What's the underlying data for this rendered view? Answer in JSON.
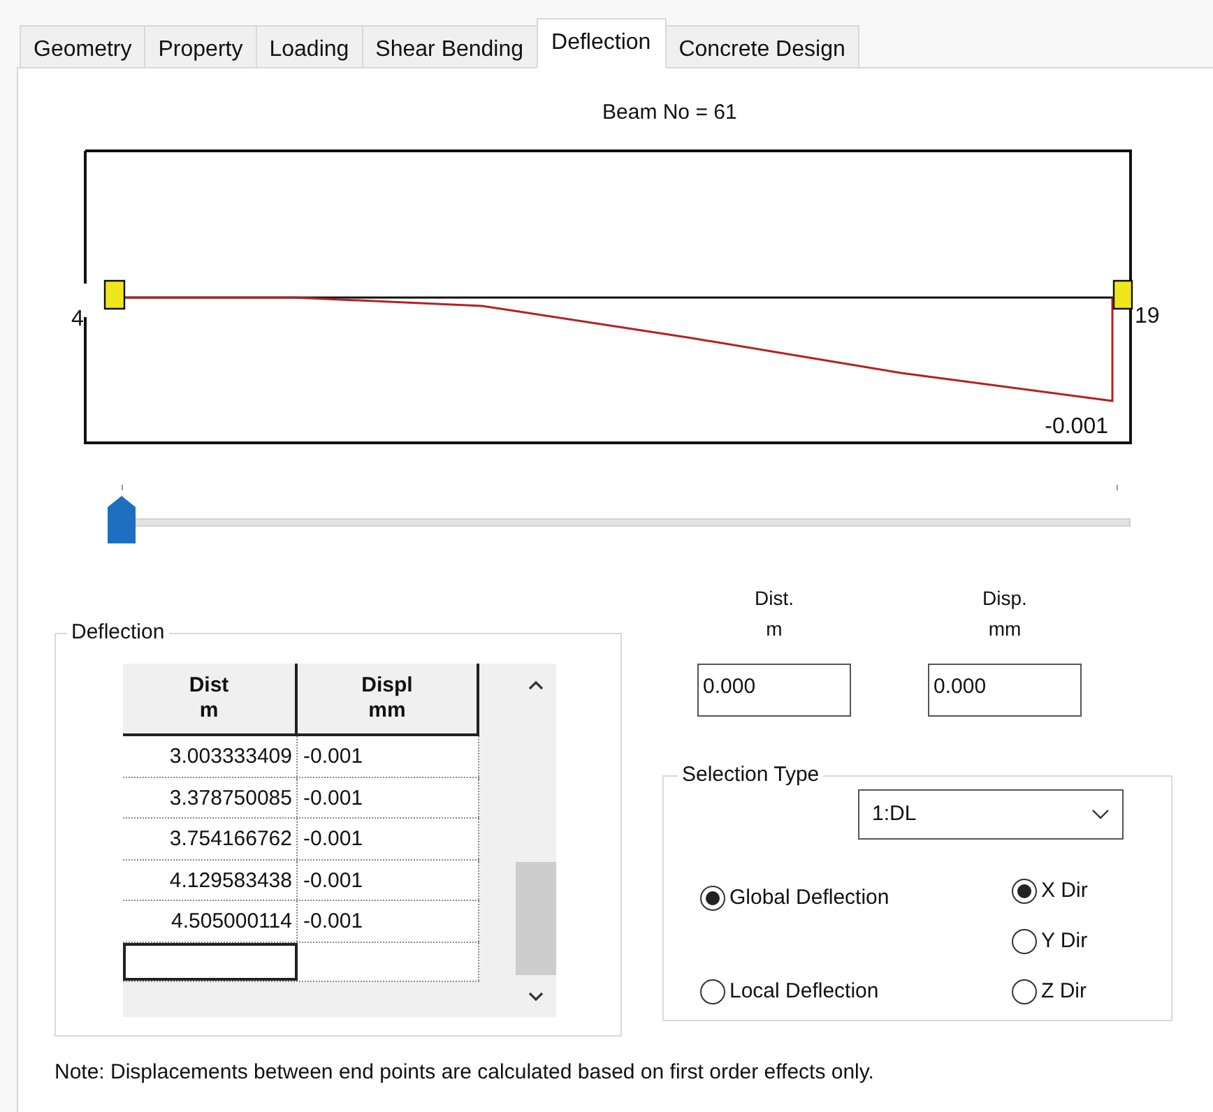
{
  "tabs": [
    {
      "label": "Geometry",
      "selected": false
    },
    {
      "label": "Property",
      "selected": false
    },
    {
      "label": "Loading",
      "selected": false
    },
    {
      "label": "Shear Bending",
      "selected": false
    },
    {
      "label": "Deflection",
      "selected": true
    },
    {
      "label": "Concrete Design",
      "selected": false
    }
  ],
  "beam_title": "Beam No = 61",
  "diagram": {
    "start_node": "4",
    "end_node": "19",
    "max_value": "-0.001"
  },
  "slider": {
    "level": 0
  },
  "deflection_table": {
    "title": "Deflection",
    "columns": [
      {
        "title": "Dist",
        "unit": "m"
      },
      {
        "title": "Displ",
        "unit": "mm"
      }
    ],
    "rows": [
      [
        "3.003333409",
        "-0.001"
      ],
      [
        "3.378750085",
        "-0.001"
      ],
      [
        "3.754166762",
        "-0.001"
      ],
      [
        "4.129583438",
        "-0.001"
      ],
      [
        "4.505000114",
        "-0.001"
      ]
    ]
  },
  "fields": [
    {
      "label": "Dist.",
      "unit": "m",
      "value": "0.000"
    },
    {
      "label": "Disp.",
      "unit": "mm",
      "value": "0.000"
    }
  ],
  "selection_type": {
    "title": "Selection Type",
    "load_case": "1:DL",
    "deflection_options": [
      {
        "label": "Global Deflection",
        "selected": true
      },
      {
        "label": "Local Deflection",
        "selected": false
      }
    ],
    "direction_options": [
      {
        "label": "X Dir",
        "selected": true
      },
      {
        "label": "Y Dir",
        "selected": false
      },
      {
        "label": "Z Dir",
        "selected": false
      }
    ]
  },
  "note": "Note: Displacements between end points are calculated based on first order effects only."
}
